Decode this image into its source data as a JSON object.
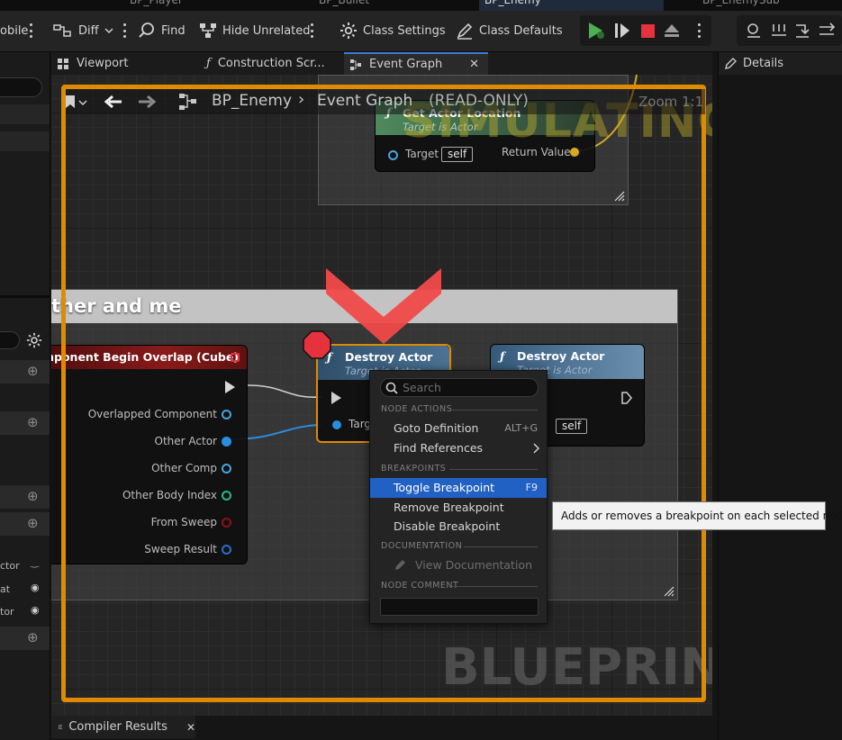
{
  "colors": {
    "accent_selection": "#2261c4",
    "simulating_border": "#e08a00",
    "breakpoint_red": "#e5323c",
    "pure_node_header": "#3f6d4c",
    "function_node_header": "#2f4f6b",
    "event_node_header": "#8a1a1a"
  },
  "doc_tabs": [
    "BP_Player",
    "BP_Bullet",
    "BP_Enemy",
    "BP_EnemySub"
  ],
  "toolbar": {
    "partial_left": "obile",
    "diff": "Diff",
    "find": "Find",
    "hide_unrelated": "Hide Unrelated",
    "class_settings": "Class Settings",
    "class_defaults": "Class Defaults"
  },
  "graph_tabs": {
    "viewport": "Viewport",
    "construction": "Construction Scr...",
    "event_graph": "Event Graph"
  },
  "details": {
    "title": "Details"
  },
  "breadcrumb": {
    "blueprint": "BP_Enemy",
    "graph": "Event Graph",
    "mode": "(READ-ONLY)",
    "zoom": "Zoom 1:1"
  },
  "watermarks": {
    "simulating": "SIMULATING",
    "blueprint": "BLUEPRINT"
  },
  "comment_box": {
    "title_partial": "ther and me"
  },
  "nodes": {
    "get_actor_location": {
      "title": "Get Actor Location",
      "subtitle": "Target is Actor",
      "target_label": "Target",
      "target_value": "self",
      "return_label": "Return Value"
    },
    "event_overlap": {
      "title": "mponent Begin Overlap (Cube)",
      "pins": [
        "Overlapped Component",
        "Other Actor",
        "Other Comp",
        "Other Body Index",
        "From Sweep",
        "Sweep Result"
      ]
    },
    "destroy_actor_1": {
      "title": "Destroy Actor",
      "subtitle": "Target is Actor",
      "target_label": "Targ"
    },
    "destroy_actor_2": {
      "title": "Destroy Actor",
      "subtitle": "Target is Actor",
      "target_label": "et",
      "target_value": "self"
    }
  },
  "left_panel": {
    "labels": [
      "ctor",
      "at",
      "tor"
    ]
  },
  "context_menu": {
    "search_placeholder": "Search",
    "sections": {
      "node_actions": "NODE ACTIONS",
      "breakpoints": "BREAKPOINTS",
      "documentation": "DOCUMENTATION",
      "node_comment": "NODE COMMENT"
    },
    "items": {
      "goto_definition": {
        "label": "Goto Definition",
        "shortcut": "ALT+G"
      },
      "find_references": {
        "label": "Find References"
      },
      "toggle_breakpoint": {
        "label": "Toggle Breakpoint",
        "shortcut": "F9"
      },
      "remove_breakpoint": {
        "label": "Remove Breakpoint"
      },
      "disable_breakpoint": {
        "label": "Disable Breakpoint"
      },
      "view_documentation": {
        "label": "View Documentation"
      }
    }
  },
  "tooltip": "Adds or removes a breakpoint on each selected node",
  "bottom": {
    "compiler_results": "Compiler Results"
  }
}
